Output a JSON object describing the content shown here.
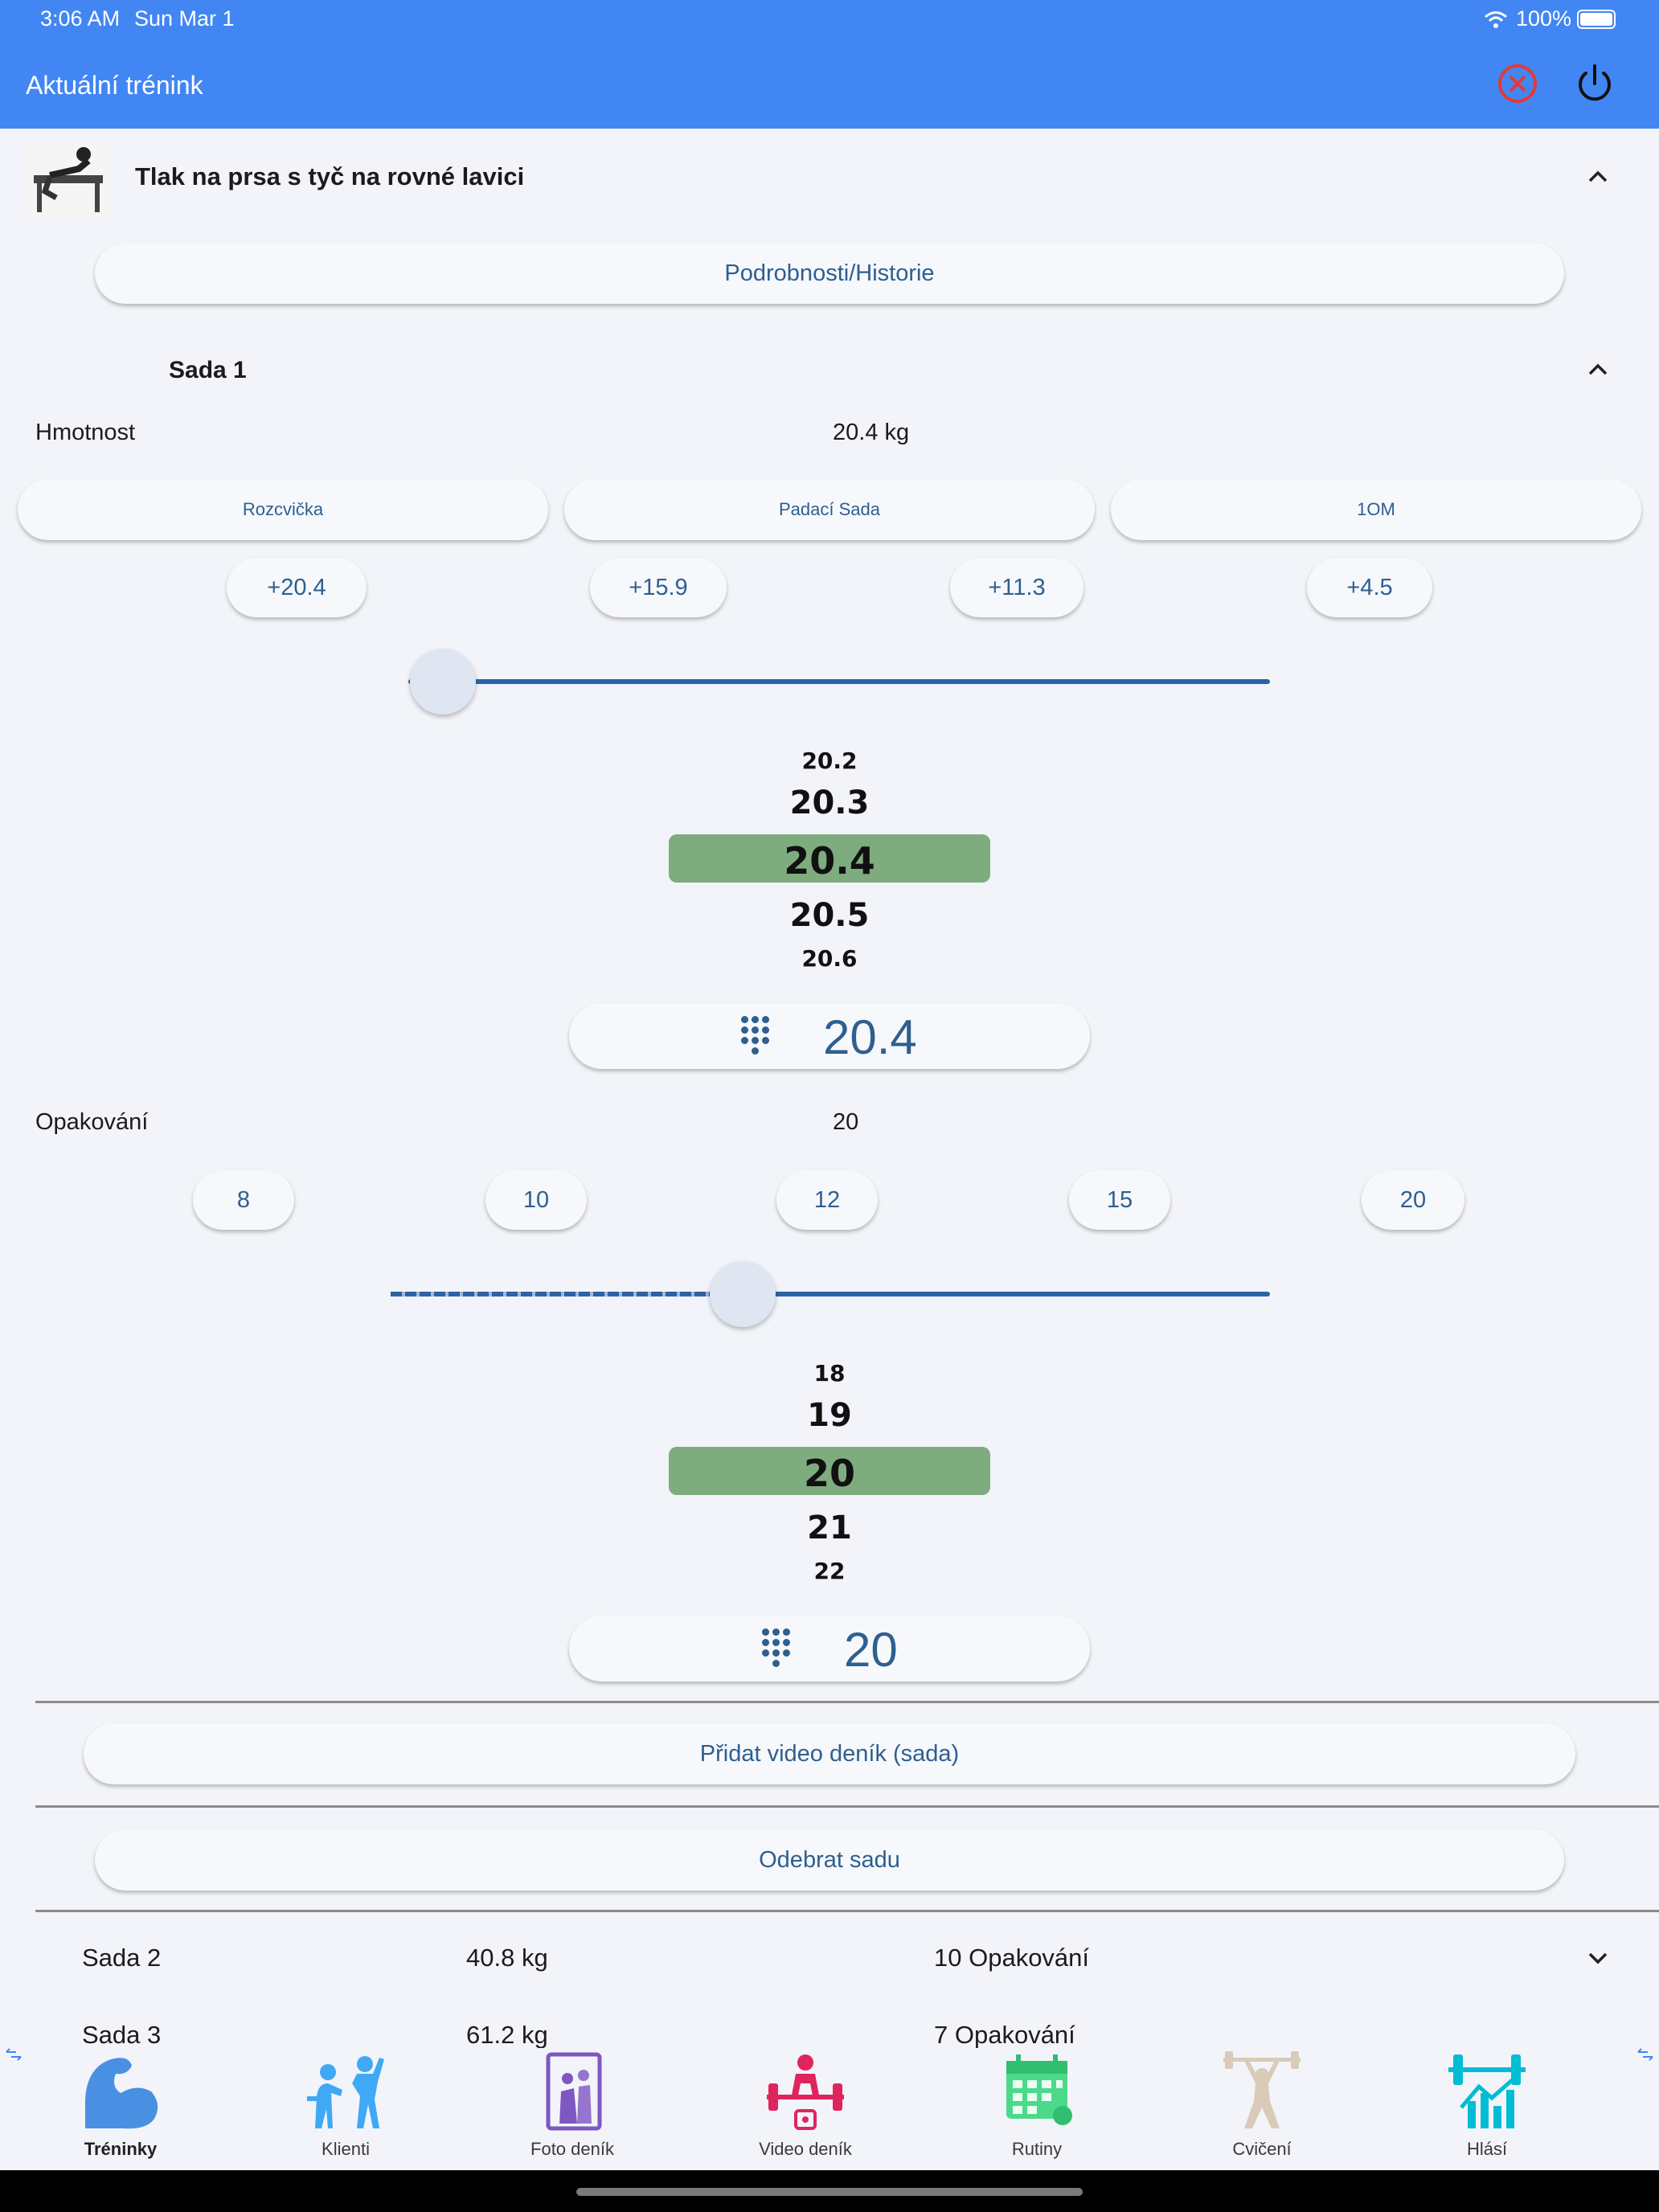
{
  "status": {
    "time": "3:06 AM",
    "date": "Sun Mar 1",
    "battery": "100%"
  },
  "appbar": {
    "title": "Aktuální trénink"
  },
  "exercise": {
    "name": "Tlak na prsa s tyč na rovné lavici",
    "details_button": "Podrobnosti/Historie"
  },
  "set1": {
    "title": "Sada 1",
    "weight": {
      "label": "Hmotnost",
      "value": "20.4 kg",
      "type_buttons": [
        "Rozcvička",
        "Padací Sada",
        "1OM"
      ],
      "increments": [
        "+20.4",
        "+15.9",
        "+11.3",
        "+4.5"
      ],
      "slider_level": 0.04,
      "wheel": [
        "20.2",
        "20.3",
        "20.4",
        "20.5",
        "20.6"
      ],
      "entry": "20.4"
    },
    "reps": {
      "label": "Opakování",
      "value": "20",
      "quick": [
        "8",
        "10",
        "12",
        "15",
        "20"
      ],
      "slider_level": 0.4,
      "wheel": [
        "18",
        "19",
        "20",
        "21",
        "22"
      ],
      "entry": "20"
    },
    "add_video": "Přidat video deník (sada)",
    "remove_set": "Odebrat sadu"
  },
  "other_sets": [
    {
      "name": "Sada 2",
      "weight": "40.8 kg",
      "reps": "10 Opakování"
    },
    {
      "name": "Sada 3",
      "weight": "61.2 kg",
      "reps": "7 Opakování"
    }
  ],
  "nav": {
    "items": [
      {
        "label": "Tréninky",
        "icon": "flexed-arm-icon",
        "active": true
      },
      {
        "label": "Klienti",
        "icon": "trainer-client-icon"
      },
      {
        "label": "Foto deník",
        "icon": "mirror-photo-icon"
      },
      {
        "label": "Video deník",
        "icon": "deadlift-video-icon"
      },
      {
        "label": "Rutiny",
        "icon": "calendar-icon"
      },
      {
        "label": "Cvičení",
        "icon": "weightlifter-icon"
      },
      {
        "label": "Hlásí",
        "icon": "barbell-chart-icon"
      }
    ]
  },
  "colors": {
    "appbar": "#4286f4",
    "accent": "#2e5f8f",
    "wheel_selection": "#7fac7f",
    "close": "#e53935"
  }
}
